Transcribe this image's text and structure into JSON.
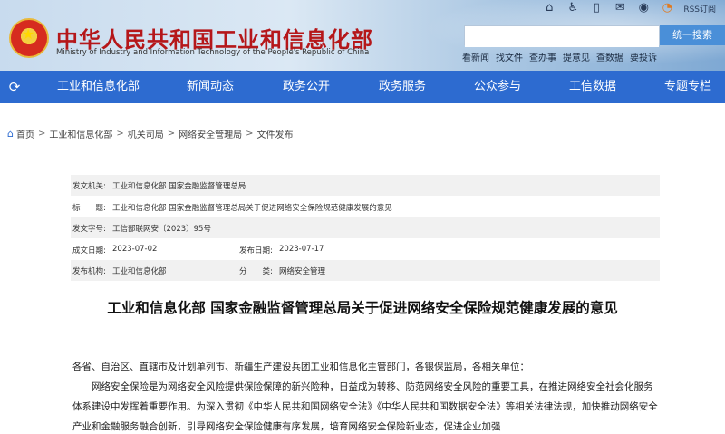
{
  "header": {
    "title": "中华人民共和国工业和信息化部",
    "subtitle": "Ministry of Industry and Information Technology of the People's Republic of China",
    "icons": [
      "home-icon",
      "accessibility-icon",
      "mobile-icon",
      "mail-icon",
      "weibo-icon",
      "rss-icon"
    ],
    "rss_label": "RSS订阅",
    "search": {
      "placeholder": "",
      "button_label": "统一搜索"
    },
    "quick_links": [
      "看新闻",
      "找文件",
      "查办事",
      "提意见",
      "查数据",
      "要投诉"
    ]
  },
  "nav": {
    "items": [
      "工业和信息化部",
      "新闻动态",
      "政务公开",
      "政务服务",
      "公众参与",
      "工信数据",
      "专题专栏"
    ],
    "color": "#2d6bd0"
  },
  "breadcrumb": [
    "首页",
    "工业和信息化部",
    "机关司局",
    "网络安全管理局",
    "文件发布"
  ],
  "info": {
    "issuer_label": "发文机关:",
    "issuer": "工业和信息化部 国家金融监督管理总局",
    "title_label": "标　　题:",
    "title": "工业和信息化部 国家金融监督管理总局关于促进网络安全保险规范健康发展的意见",
    "doc_no_label": "发文字号:",
    "doc_no": "工信部联网安〔2023〕95号",
    "date_label": "成文日期:",
    "date": "2023-07-02",
    "pub_date_label": "发布日期:",
    "pub_date": "2023-07-17",
    "publisher_label": "发布机构:",
    "publisher": "工业和信息化部",
    "category_label": "分　　类:",
    "category": "网络安全管理"
  },
  "article": {
    "title": "工业和信息化部 国家金融监督管理总局关于促进网络安全保险规范健康发展的意见",
    "p1": "各省、自治区、直辖市及计划单列市、新疆生产建设兵团工业和信息化主管部门，各银保监局，各相关单位：",
    "p2": "　　网络安全保险是为网络安全风险提供保险保障的新兴险种，日益成为转移、防范网络安全风险的重要工具，在推进网络安全社会化服务体系建设中发挥着重要作用。为深入贯彻《中华人民共和国网络安全法》《中华人民共和国数据安全法》等相关法律法规，加快推动网络安全产业和金融服务融合创新，引导网络安全保险健康有序发展，培育网络安全保险新业态，促进企业加强"
  }
}
